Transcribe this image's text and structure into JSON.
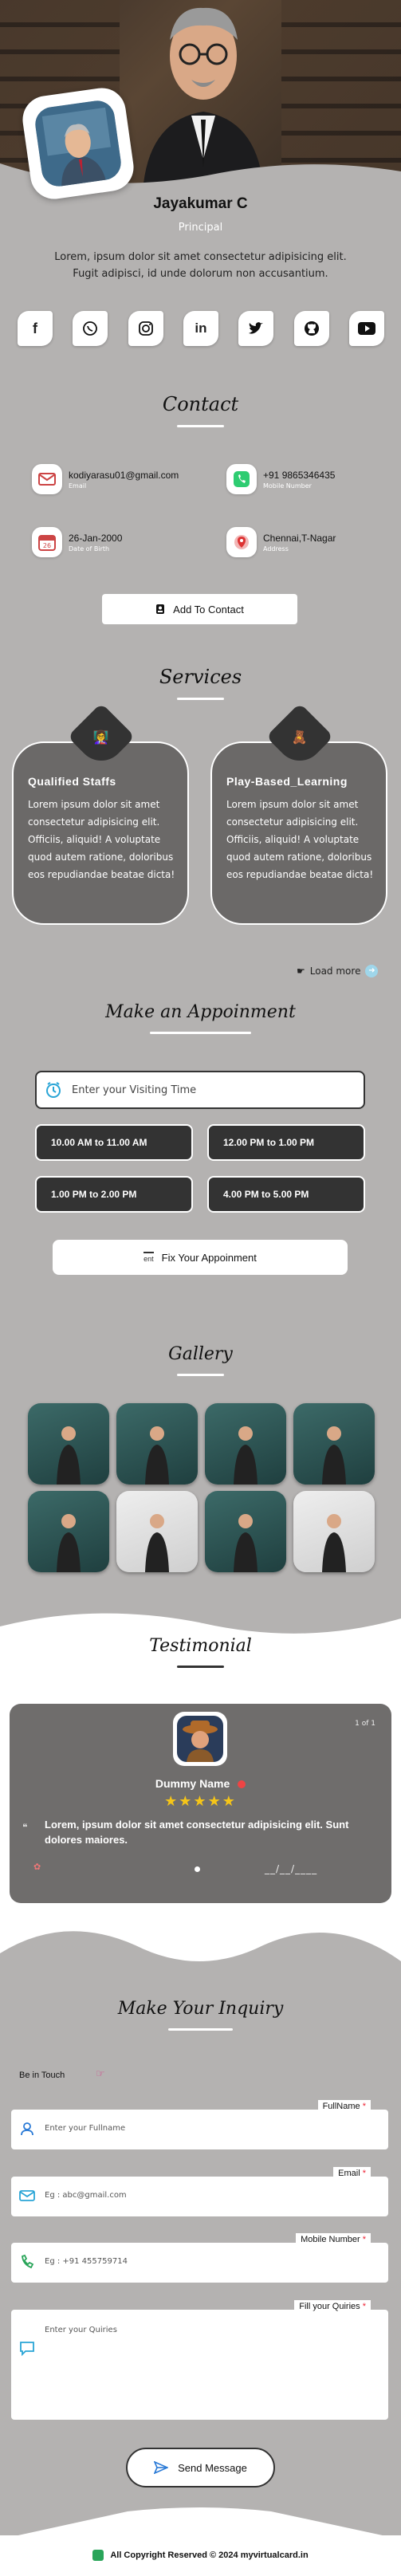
{
  "profile": {
    "name": "Jayakumar C",
    "role": "Principal",
    "bio": "Lorem, ipsum dolor sit amet consectetur adipisicing elit. Fugit adipisci, id unde dolorum non accusantium."
  },
  "socials": [
    "facebook-icon",
    "whatsapp-icon",
    "instagram-icon",
    "linkedin-icon",
    "twitter-icon",
    "github-icon",
    "youtube-icon"
  ],
  "contact": {
    "title": "Contact",
    "items": [
      {
        "value": "kodiyarasu01@gmail.com",
        "label": "Email"
      },
      {
        "value": "+91 9865346435",
        "label": "Mobile Number"
      },
      {
        "value": "26-Jan-2000",
        "label": "Date of Birth"
      },
      {
        "value": "Chennai,T-Nagar",
        "label": "Address"
      }
    ],
    "add_button": "Add To Contact"
  },
  "services": {
    "title": "Services",
    "items": [
      {
        "title": "Qualified Staffs",
        "text": "Lorem ipsum dolor sit amet consectetur adipisicing elit. Officiis, aliquid! A voluptate quod autem ratione, doloribus eos repudiandae beatae dicta!"
      },
      {
        "title": "Play-Based_Learning",
        "text": "Lorem ipsum dolor sit amet consectetur adipisicing elit. Officiis, aliquid! A voluptate quod autem ratione, doloribus eos repudiandae beatae dicta!"
      }
    ],
    "load_more": "Load more"
  },
  "appointment": {
    "title": "Make an Appoinment",
    "time_placeholder": "Enter your Visiting Time",
    "slots": [
      "10.00 AM to 11.00 AM",
      "12.00 PM to 1.00 PM",
      "1.00 PM to 2.00 PM",
      "4.00 PM to 5.00 PM"
    ],
    "fix_button": "Fix Your Appoinment",
    "fix_icon_alt": "ent"
  },
  "gallery": {
    "title": "Gallery"
  },
  "testimonial": {
    "title": "Testimonial",
    "counter": "1 of 1",
    "name": "Dummy Name",
    "stars": "★★★★★",
    "text": "Lorem, ipsum dolor sit amet consectetur adipisicing elit. Sunt dolores maiores.",
    "date": "__/__/____"
  },
  "inquiry": {
    "title": "Make Your Inquiry",
    "be_in_touch": "Be in Touch",
    "fields": [
      {
        "label": "FullName",
        "placeholder": "Enter your Fullname"
      },
      {
        "label": "Email",
        "placeholder": "Eg : abc@gmail.com"
      },
      {
        "label": "Mobile Number",
        "placeholder": "Eg : +91 455759714"
      },
      {
        "label": "Fill your Quiries",
        "placeholder": "Enter your Quiries"
      }
    ],
    "required_mark": "*",
    "send_button": "Send Message"
  },
  "footer": {
    "text": "All Copyright Reserved © 2024 myvirtualcard.in"
  },
  "colors": {
    "background": "#b4b2b1",
    "accent": "#ffffff",
    "dark": "#333333",
    "star": "#f5c518"
  }
}
